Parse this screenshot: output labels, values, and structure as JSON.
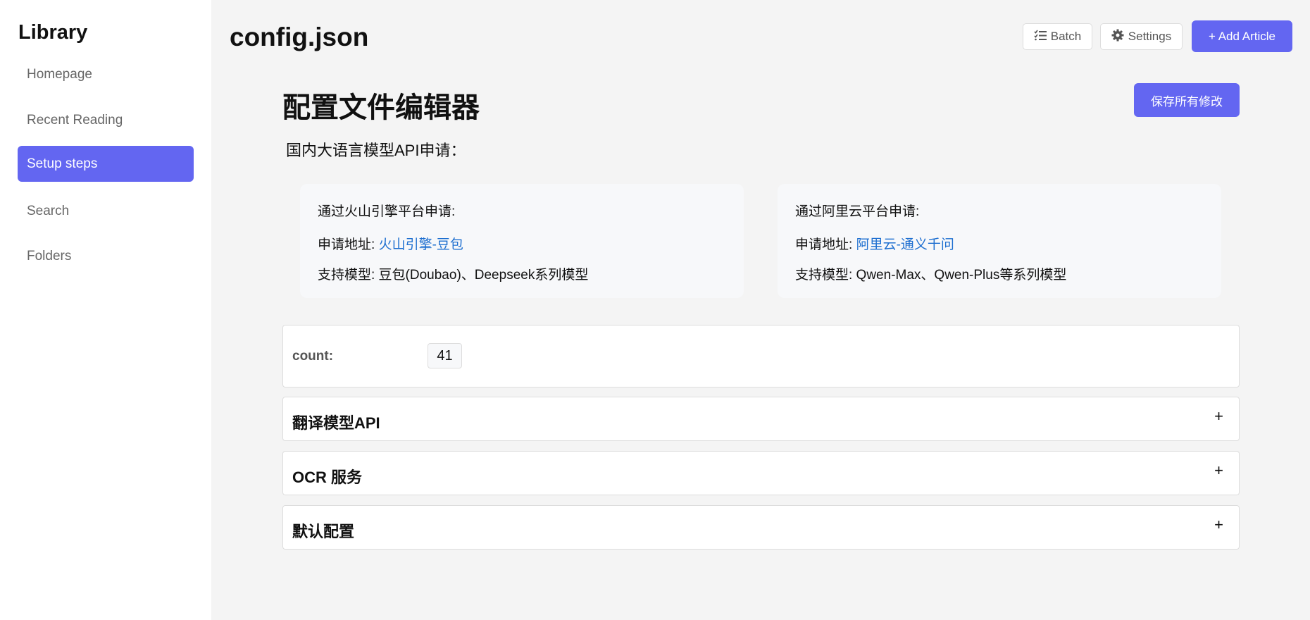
{
  "sidebar": {
    "title": "Library",
    "items": [
      {
        "label": "Homepage"
      },
      {
        "label": "Recent Reading"
      },
      {
        "label": "Setup steps",
        "active": true
      },
      {
        "label": "Search"
      },
      {
        "label": "Folders"
      }
    ]
  },
  "header": {
    "title": "config.json",
    "batch": "Batch",
    "settings": "Settings",
    "add": "+ Add Article"
  },
  "main": {
    "title": "配置文件编辑器",
    "save": "保存所有修改",
    "subtitle": "国内大语言模型API申请：",
    "cards": [
      {
        "heading": "通过火山引擎平台申请:",
        "addr_label": "申请地址: ",
        "addr_link": "火山引擎-豆包",
        "models_label": "支持模型: 豆包(Doubao)、Deepseek系列模型"
      },
      {
        "heading": "通过阿里云平台申请:",
        "addr_label": "申请地址: ",
        "addr_link": "阿里云-通义千问",
        "models_label": "支持模型: Qwen-Max、Qwen-Plus等系列模型"
      }
    ],
    "count_label": "count:",
    "count_value": "41",
    "sections": [
      {
        "title": "翻译模型API",
        "toggle": "+"
      },
      {
        "title": "OCR 服务",
        "toggle": "+"
      },
      {
        "title": "默认配置",
        "toggle": "+"
      }
    ]
  },
  "colors": {
    "accent": "#6366f1",
    "link": "#1e6fd0"
  }
}
